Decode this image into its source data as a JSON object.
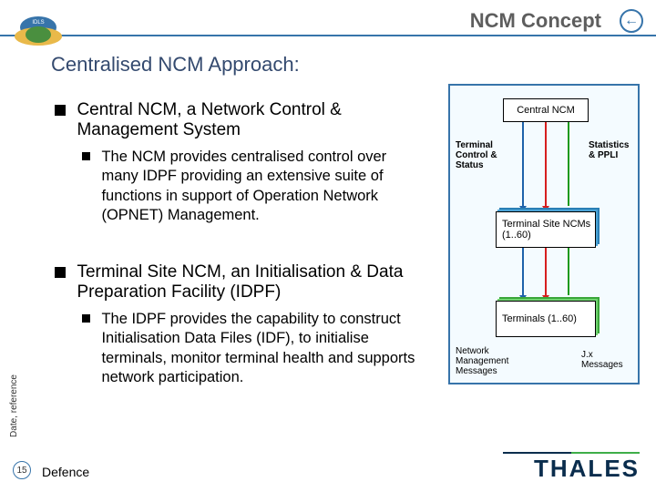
{
  "title": "NCM Concept",
  "subtitle": "Centralised NCM Approach:",
  "nav_back_glyph": "←",
  "bullets": {
    "b1a": "Central NCM, a Network Control & Management System",
    "b1a_sub": "The NCM provides centralised control over many IDPF providing an extensive suite of functions in support of Operation Network (OPNET) Management.",
    "b1b": "Terminal Site NCM, an Initialisation & Data Preparation Facility (IDPF)",
    "b1b_sub": "The IDPF provides the capability to construct Initialisation Data Files (IDF), to initialise terminals, monitor terminal health and supports network participation."
  },
  "diagram": {
    "box_central": "Central NCM",
    "box_sites": "Terminal Site NCMs (1..60)",
    "box_terminals": "Terminals (1..60)",
    "label_left_top": "Terminal Control & Status",
    "label_right_top": "Statistics & PPLI",
    "label_left_bottom": "Network Management Messages",
    "label_right_bottom": "J.x Messages"
  },
  "side_label": "Date, reference",
  "page_number": "15",
  "footer": "Defence",
  "logo": "THALES"
}
